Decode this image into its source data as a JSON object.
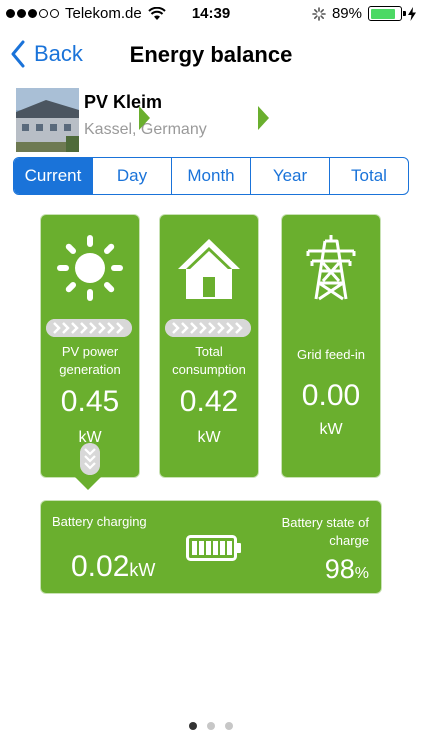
{
  "status_bar": {
    "carrier": "Telekom.de",
    "time": "14:39",
    "battery": "89%"
  },
  "nav": {
    "back_label": "Back",
    "title": "Energy balance"
  },
  "plant": {
    "name": "PV Kleim",
    "location": "Kassel, Germany"
  },
  "tabs": [
    {
      "label": "Current",
      "active": true
    },
    {
      "label": "Day",
      "active": false
    },
    {
      "label": "Month",
      "active": false
    },
    {
      "label": "Year",
      "active": false
    },
    {
      "label": "Total",
      "active": false
    }
  ],
  "cards": {
    "pv": {
      "label_line1": "PV power",
      "label_line2": "generation",
      "value": "0.45",
      "unit": "kW",
      "icon": "sun-icon"
    },
    "consumption": {
      "label_line1": "Total",
      "label_line2": "consumption",
      "value": "0.42",
      "unit": "kW",
      "icon": "house-icon"
    },
    "grid": {
      "label": "Grid feed-in",
      "value": "0.00",
      "unit": "kW",
      "icon": "power-pylon-icon"
    }
  },
  "battery": {
    "charging_label": "Battery charging",
    "charging_value": "0.02",
    "charging_unit": "kW",
    "soc_label": "Battery state of charge",
    "soc_value": "98",
    "soc_unit": "%"
  },
  "pager": {
    "count": 3,
    "active": 0
  },
  "colors": {
    "accent": "#1a73d9",
    "card_green": "#6aaf2e",
    "battery_level_green": "#4cd964"
  }
}
